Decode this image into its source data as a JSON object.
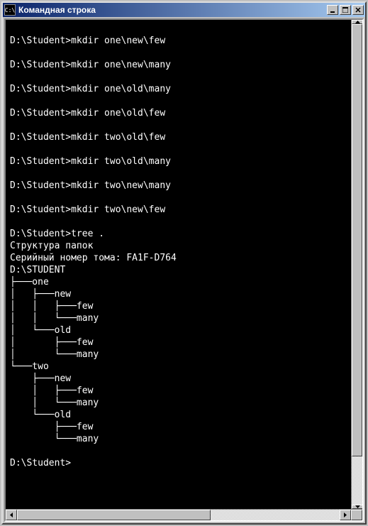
{
  "window": {
    "title": "Командная строка"
  },
  "terminal": {
    "content": "\nD:\\Student>mkdir one\\new\\few\n\nD:\\Student>mkdir one\\new\\many\n\nD:\\Student>mkdir one\\old\\many\n\nD:\\Student>mkdir one\\old\\few\n\nD:\\Student>mkdir two\\old\\few\n\nD:\\Student>mkdir two\\old\\many\n\nD:\\Student>mkdir two\\new\\many\n\nD:\\Student>mkdir two\\new\\few\n\nD:\\Student>tree .\nСтруктура папок\nСерийный номер тома: FA1F-D764\nD:\\STUDENT\n├───one\n│   ├───new\n│   │   ├───few\n│   │   └───many\n│   └───old\n│       ├───few\n│       └───many\n└───two\n    ├───new\n    │   ├───few\n    │   └───many\n    └───old\n        ├───few\n        └───many\n\nD:\\Student>"
  },
  "buttons": {
    "minimize": "_",
    "maximize": "□",
    "close": "✕"
  },
  "scroll": {
    "left": "◄",
    "right": "►",
    "up": "▲",
    "down": "▼"
  }
}
